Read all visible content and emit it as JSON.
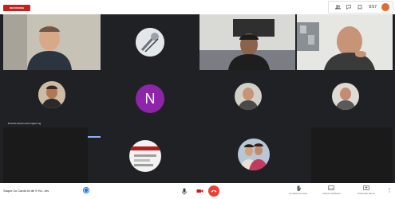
{
  "top_bar": {
    "recording_badge": "RECORDING",
    "icons": [
      "people-icon",
      "chat-icon",
      "activities-icon"
    ],
    "time": "9:57",
    "avatar_color": "#e06c2c"
  },
  "tiles": {
    "speaking_label": "Ernesto Ascemonica Ingles Ing",
    "initial": "N",
    "initial_color": "#8e24aa"
  },
  "bottom_bar": {
    "meeting_details": "Saque 2o Cardo fa de 9 Hu...ies",
    "actions": [
      {
        "icon": "hand-icon",
        "label": "Levantar la mano"
      },
      {
        "icon": "captions-icon",
        "label": "Activar subtítulos"
      },
      {
        "icon": "present-icon",
        "label": "Presentar ahora"
      }
    ],
    "more_icon": "⋮"
  },
  "colors": {
    "grid_bg": "#202124",
    "tile_bg": "#3c4043",
    "end_call": "#ea4335",
    "speaker_highlight": "#8ab4f8"
  }
}
